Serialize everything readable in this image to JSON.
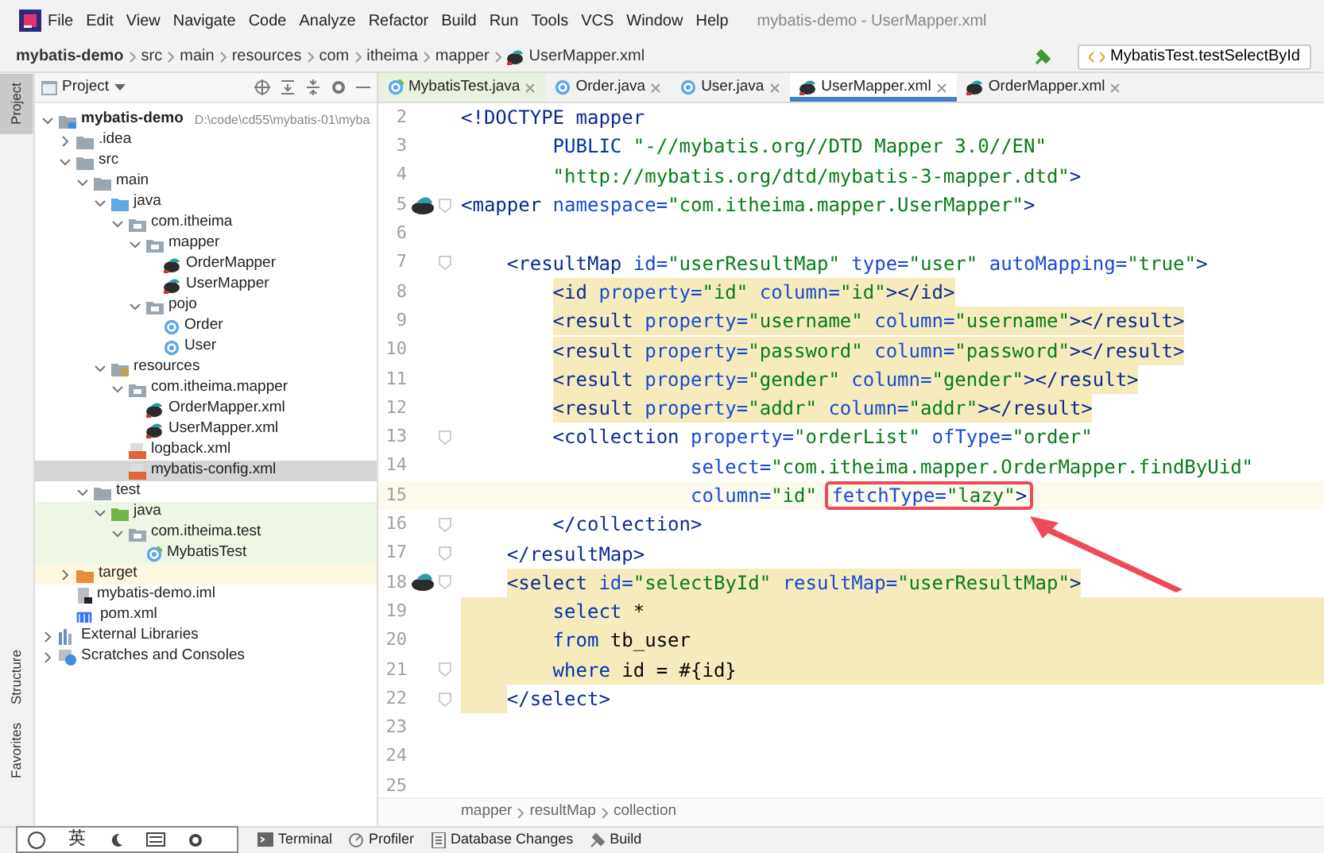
{
  "window": {
    "title": "mybatis-demo - UserMapper.xml"
  },
  "menu": [
    "File",
    "Edit",
    "View",
    "Navigate",
    "Code",
    "Analyze",
    "Refactor",
    "Build",
    "Run",
    "Tools",
    "VCS",
    "Window",
    "Help"
  ],
  "breadcrumbs": [
    {
      "label": "mybatis-demo",
      "kind": "project"
    },
    {
      "label": "src",
      "kind": "folder"
    },
    {
      "label": "main",
      "kind": "folder"
    },
    {
      "label": "resources",
      "kind": "folder"
    },
    {
      "label": "com",
      "kind": "folder"
    },
    {
      "label": "itheima",
      "kind": "folder"
    },
    {
      "label": "mapper",
      "kind": "folder"
    },
    {
      "label": "UserMapper.xml",
      "kind": "mapper"
    }
  ],
  "run_config": {
    "label": "MybatisTest.testSelectById"
  },
  "side_tabs": {
    "top": [
      {
        "label": "Project",
        "selected": true
      }
    ],
    "bottom": [
      {
        "label": "Structure",
        "selected": false
      },
      {
        "label": "Favorites",
        "selected": false
      }
    ]
  },
  "project_panel": {
    "title": "Project",
    "tree": [
      {
        "label": "mybatis-demo",
        "kind": "module",
        "path": "D:\\code\\cd55\\mybatis-01\\myba",
        "expanded": true,
        "selected": false,
        "children": [
          {
            "label": ".idea",
            "kind": "folder",
            "expanded": false,
            "selected": false
          },
          {
            "label": "src",
            "kind": "folder",
            "expanded": true,
            "selected": false,
            "children": [
              {
                "label": "main",
                "kind": "folder",
                "expanded": true,
                "selected": false,
                "children": [
                  {
                    "label": "java",
                    "kind": "source-folder",
                    "expanded": true,
                    "selected": false,
                    "children": [
                      {
                        "label": "com.itheima",
                        "kind": "package",
                        "expanded": true,
                        "selected": false,
                        "children": [
                          {
                            "label": "mapper",
                            "kind": "package",
                            "expanded": true,
                            "selected": false,
                            "children": [
                              {
                                "label": "OrderMapper",
                                "kind": "mapper",
                                "selected": false
                              },
                              {
                                "label": "UserMapper",
                                "kind": "mapper",
                                "selected": false
                              }
                            ]
                          },
                          {
                            "label": "pojo",
                            "kind": "package",
                            "expanded": true,
                            "selected": false,
                            "children": [
                              {
                                "label": "Order",
                                "kind": "class",
                                "selected": false
                              },
                              {
                                "label": "User",
                                "kind": "class",
                                "selected": false
                              }
                            ]
                          }
                        ]
                      }
                    ]
                  },
                  {
                    "label": "resources",
                    "kind": "resource-folder",
                    "expanded": true,
                    "selected": false,
                    "children": [
                      {
                        "label": "com.itheima.mapper",
                        "kind": "package",
                        "expanded": true,
                        "selected": false,
                        "children": [
                          {
                            "label": "OrderMapper.xml",
                            "kind": "mapper",
                            "selected": false
                          },
                          {
                            "label": "UserMapper.xml",
                            "kind": "mapper",
                            "selected": false
                          }
                        ]
                      },
                      {
                        "label": "logback.xml",
                        "kind": "xml",
                        "selected": false
                      },
                      {
                        "label": "mybatis-config.xml",
                        "kind": "xml",
                        "selected": true
                      }
                    ]
                  }
                ]
              },
              {
                "label": "test",
                "kind": "folder",
                "expanded": true,
                "selected": false,
                "children": [
                  {
                    "label": "java",
                    "kind": "test-folder",
                    "expanded": true,
                    "selected": false,
                    "children": [
                      {
                        "label": "com.itheima.test",
                        "kind": "test-package",
                        "expanded": true,
                        "selected": false,
                        "children": [
                          {
                            "label": "MybatisTest",
                            "kind": "test-class",
                            "selected": false
                          }
                        ]
                      }
                    ]
                  }
                ]
              }
            ]
          },
          {
            "label": "target",
            "kind": "excluded-folder",
            "expanded": false,
            "selected": false
          },
          {
            "label": "mybatis-demo.iml",
            "kind": "iml",
            "selected": false
          },
          {
            "label": "pom.xml",
            "kind": "pom",
            "selected": false
          }
        ]
      },
      {
        "label": "External Libraries",
        "kind": "libraries",
        "expanded": false,
        "selected": false
      },
      {
        "label": "Scratches and Consoles",
        "kind": "scratches",
        "expanded": false,
        "selected": false
      }
    ]
  },
  "editor_tabs": [
    {
      "label": "MybatisTest.java",
      "kind": "test-class",
      "selected": false
    },
    {
      "label": "Order.java",
      "kind": "class",
      "selected": false
    },
    {
      "label": "User.java",
      "kind": "class",
      "selected": false
    },
    {
      "label": "UserMapper.xml",
      "kind": "mapper",
      "selected": true
    },
    {
      "label": "OrderMapper.xml",
      "kind": "mapper",
      "selected": false
    }
  ],
  "code_lines": [
    {
      "number": "2",
      "kind": "plain",
      "segments": [
        {
          "kind": "tag",
          "text": "<!DOCTYPE mapper"
        }
      ]
    },
    {
      "number": "3",
      "kind": "plain",
      "segments": [
        {
          "kind": "keyword",
          "text": "        PUBLIC"
        },
        {
          "kind": "value",
          "text": " \"-//mybatis.org//DTD Mapper 3.0//EN\""
        }
      ]
    },
    {
      "number": "4",
      "kind": "plain",
      "segments": [
        {
          "kind": "value",
          "text": "        \"http://mybatis.org/dtd/mybatis-3-mapper.dtd\""
        },
        {
          "kind": "tag",
          "text": ">"
        }
      ]
    },
    {
      "number": "5",
      "kind": "plain",
      "mapper_icon": true,
      "fold": true,
      "segments": [
        {
          "kind": "tag",
          "text": "<mapper"
        },
        {
          "kind": "attr",
          "text": " namespace="
        },
        {
          "kind": "value",
          "text": "\"com.itheima.mapper.UserMapper\""
        },
        {
          "kind": "tag",
          "text": ">"
        }
      ]
    },
    {
      "number": "6",
      "kind": "plain"
    },
    {
      "number": "7",
      "kind": "plain",
      "fold": true,
      "segments": [
        {
          "kind": "tag",
          "text": "    <resultMap"
        },
        {
          "kind": "attr",
          "text": " id="
        },
        {
          "kind": "value",
          "text": "\"userResultMap\""
        },
        {
          "kind": "attr",
          "text": " type="
        },
        {
          "kind": "value",
          "text": "\"user\""
        },
        {
          "kind": "attr",
          "text": " autoMapping="
        },
        {
          "kind": "value",
          "text": "\"true\""
        },
        {
          "kind": "tag",
          "text": ">"
        }
      ]
    },
    {
      "number": "8",
      "kind": "marked",
      "segments": [
        {
          "kind": "tag",
          "text": "        <id"
        },
        {
          "kind": "attr",
          "text": " property="
        },
        {
          "kind": "value",
          "text": "\"id\""
        },
        {
          "kind": "attr",
          "text": " column="
        },
        {
          "kind": "value",
          "text": "\"id\""
        },
        {
          "kind": "tag",
          "text": "></id>"
        }
      ]
    },
    {
      "number": "9",
      "kind": "marked",
      "segments": [
        {
          "kind": "tag",
          "text": "        <result"
        },
        {
          "kind": "attr",
          "text": " property="
        },
        {
          "kind": "value",
          "text": "\"username\""
        },
        {
          "kind": "attr",
          "text": " column="
        },
        {
          "kind": "value",
          "text": "\"username\""
        },
        {
          "kind": "tag",
          "text": "></result>"
        }
      ]
    },
    {
      "number": "10",
      "kind": "marked",
      "segments": [
        {
          "kind": "tag",
          "text": "        <result"
        },
        {
          "kind": "attr",
          "text": " property="
        },
        {
          "kind": "value",
          "text": "\"password\""
        },
        {
          "kind": "attr",
          "text": " column="
        },
        {
          "kind": "value",
          "text": "\"password\""
        },
        {
          "kind": "tag",
          "text": "></result>"
        }
      ]
    },
    {
      "number": "11",
      "kind": "marked",
      "segments": [
        {
          "kind": "tag",
          "text": "        <result"
        },
        {
          "kind": "attr",
          "text": " property="
        },
        {
          "kind": "value",
          "text": "\"gender\""
        },
        {
          "kind": "attr",
          "text": " column="
        },
        {
          "kind": "value",
          "text": "\"gender\""
        },
        {
          "kind": "tag",
          "text": "></result>"
        }
      ]
    },
    {
      "number": "12",
      "kind": "marked",
      "segments": [
        {
          "kind": "tag",
          "text": "        <result"
        },
        {
          "kind": "attr",
          "text": " property="
        },
        {
          "kind": "value",
          "text": "\"addr\""
        },
        {
          "kind": "attr",
          "text": " column="
        },
        {
          "kind": "value",
          "text": "\"addr\""
        },
        {
          "kind": "tag",
          "text": "></result>"
        }
      ]
    },
    {
      "number": "13",
      "kind": "plain",
      "fold": true,
      "segments": [
        {
          "kind": "tag",
          "text": "        <collection"
        },
        {
          "kind": "attr",
          "text": " property="
        },
        {
          "kind": "value",
          "text": "\"orderList\""
        },
        {
          "kind": "attr",
          "text": " ofType="
        },
        {
          "kind": "value",
          "text": "\"order\""
        }
      ]
    },
    {
      "number": "14",
      "kind": "plain",
      "segments": [
        {
          "kind": "attr",
          "text": "                    select="
        },
        {
          "kind": "value",
          "text": "\"com.itheima.mapper.OrderMapper.findByUid\""
        }
      ]
    },
    {
      "number": "15",
      "kind": "plain",
      "current": true,
      "segments": [
        {
          "kind": "attr",
          "text": "                    column="
        },
        {
          "kind": "value",
          "text": "\"id\" "
        },
        {
          "kind": "attr",
          "text": "fetchType=",
          "boxed": true
        },
        {
          "kind": "value",
          "text": "\"lazy\"",
          "boxed": true
        },
        {
          "kind": "tag",
          "text": ">",
          "boxed": true
        }
      ]
    },
    {
      "number": "16",
      "kind": "plain",
      "fold": true,
      "segments": [
        {
          "kind": "tag",
          "text": "        </collection>"
        }
      ]
    },
    {
      "number": "17",
      "kind": "plain",
      "fold": true,
      "segments": [
        {
          "kind": "tag",
          "text": "    </resultMap>"
        }
      ]
    },
    {
      "number": "18",
      "kind": "marked",
      "mapper_icon": true,
      "fold": true,
      "segments": [
        {
          "kind": "tag",
          "text": "    <select"
        },
        {
          "kind": "attr",
          "text": " id="
        },
        {
          "kind": "value",
          "text": "\"selectById\""
        },
        {
          "kind": "attr",
          "text": " resultMap="
        },
        {
          "kind": "value",
          "text": "\"userResultMap\""
        },
        {
          "kind": "tag",
          "text": ">"
        }
      ]
    },
    {
      "number": "19",
      "kind": "block",
      "segments": [
        {
          "kind": "keyword",
          "text": "        select"
        },
        {
          "kind": "plain",
          "text": " *"
        }
      ]
    },
    {
      "number": "20",
      "kind": "block",
      "segments": [
        {
          "kind": "keyword",
          "text": "        from"
        },
        {
          "kind": "plain",
          "text": " tb_user"
        }
      ]
    },
    {
      "number": "21",
      "kind": "block",
      "fold": true,
      "segments": [
        {
          "kind": "keyword",
          "text": "        where"
        },
        {
          "kind": "plain",
          "text": " id = #{id}"
        }
      ]
    },
    {
      "number": "22",
      "kind": "edge",
      "fold": true,
      "segments": [
        {
          "kind": "tag",
          "text": "    </select>"
        }
      ]
    },
    {
      "number": "23",
      "kind": "plain"
    },
    {
      "number": "24",
      "kind": "plain"
    },
    {
      "number": "25",
      "kind": "plain"
    }
  ],
  "editor_breadcrumbs": [
    "mapper",
    "resultMap",
    "collection"
  ],
  "tool_windows": [
    {
      "label": "Terminal",
      "kind": "terminal"
    },
    {
      "label": "Profiler",
      "kind": "profiler"
    },
    {
      "label": "Database Changes",
      "kind": "database"
    },
    {
      "label": "Build",
      "kind": "build"
    }
  ],
  "ime_bar": {
    "mode": "英"
  }
}
